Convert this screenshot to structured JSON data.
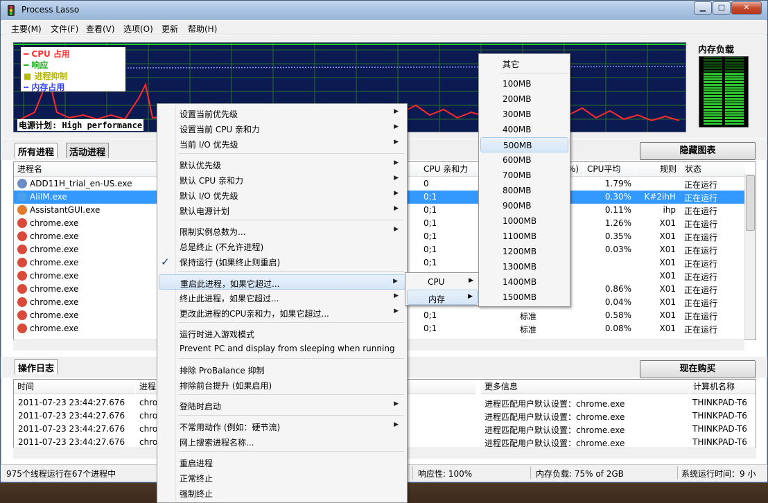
{
  "window": {
    "title": "Process Lasso",
    "min": "0",
    "max": "1",
    "close": "r"
  },
  "menu": [
    "主要(M)",
    "文件(F)",
    "查看(V)",
    "选项(O)",
    "更新",
    "帮助(H)"
  ],
  "graph": {
    "legend": [
      "CPU 占用",
      "响应",
      "进程抑制",
      "内存占用"
    ],
    "legend_colors": [
      "#ff3333",
      "#22cc22",
      "#dddd00",
      "#3344ff"
    ],
    "power_plan": "电源计划: High performance",
    "mem_title": "内存负载",
    "mem_fill": 0.75
  },
  "tabs": {
    "all": "所有进程",
    "active": "活动进程",
    "hide_graph": "隐藏图表",
    "log": "操作日志",
    "buy": "现在购买"
  },
  "proc_headers": {
    "name": "进程名",
    "affinity": "CPU 亲和力",
    "pct": "%)",
    "avg": "CPU平均",
    "rules": "规则",
    "status": "状态"
  },
  "processes": [
    {
      "name": "ADD11H_trial_en-US.exe",
      "aff": "0",
      "prio": "",
      "avg": "1.79%",
      "rule": "",
      "status": "正在运行",
      "icon": "#6b8cc4"
    },
    {
      "name": "AliIM.exe",
      "aff": "0;1",
      "prio": "",
      "avg": "0.30%",
      "rule": "K#2ihH",
      "status": "正在运行",
      "icon": "#4aa0e8",
      "sel": true
    },
    {
      "name": "AssistantGUI.exe",
      "aff": "0;1",
      "prio": "",
      "avg": "0.11%",
      "rule": "ihp",
      "status": "正在运行",
      "icon": "#e07a2c"
    },
    {
      "name": "chrome.exe",
      "aff": "0;1",
      "prio": "",
      "avg": "1.26%",
      "rule": "X01",
      "status": "正在运行",
      "icon": "#d94a3a"
    },
    {
      "name": "chrome.exe",
      "aff": "0;1",
      "prio": "",
      "avg": "0.35%",
      "rule": "X01",
      "status": "正在运行",
      "icon": "#d94a3a"
    },
    {
      "name": "chrome.exe",
      "aff": "0;1",
      "prio": "",
      "avg": "0.03%",
      "rule": "X01",
      "status": "正在运行",
      "icon": "#d94a3a"
    },
    {
      "name": "chrome.exe",
      "aff": "0;1",
      "prio": "",
      "avg": "",
      "rule": "X01",
      "status": "正在运行",
      "icon": "#d94a3a"
    },
    {
      "name": "chrome.exe",
      "aff": "",
      "prio": "",
      "avg": "",
      "rule": "X01",
      "status": "正在运行",
      "icon": "#d94a3a"
    },
    {
      "name": "chrome.exe",
      "aff": "",
      "prio": "",
      "avg": "0.86%",
      "rule": "X01",
      "status": "正在运行",
      "icon": "#d94a3a"
    },
    {
      "name": "chrome.exe",
      "aff": "",
      "prio": "",
      "avg": "0.04%",
      "rule": "X01",
      "status": "正在运行",
      "icon": "#d94a3a"
    },
    {
      "name": "chrome.exe",
      "aff": "0;1",
      "prio": "标准",
      "avg": "0.58%",
      "rule": "X01",
      "status": "正在运行",
      "icon": "#d94a3a"
    },
    {
      "name": "chrome.exe",
      "aff": "0;1",
      "prio": "标准",
      "avg": "0.08%",
      "rule": "X01",
      "status": "正在运行",
      "icon": "#d94a3a"
    }
  ],
  "log_headers": {
    "time": "时间",
    "proc": "进程",
    "info": "更多信息",
    "computer": "计算机名称"
  },
  "logs": [
    {
      "time": "2011-07-23 23:44:27.676",
      "proc": "chro",
      "info": "进程匹配用户默认设置：chrome.exe",
      "computer": "THINKPAD-T6"
    },
    {
      "time": "2011-07-23 23:44:27.676",
      "proc": "chro",
      "info": "进程匹配用户默认设置：chrome.exe",
      "computer": "THINKPAD-T6"
    },
    {
      "time": "2011-07-23 23:44:27.676",
      "proc": "chro",
      "info": "进程匹配用户默认设置：chrome.exe",
      "computer": "THINKPAD-T6"
    },
    {
      "time": "2011-07-23 23:44:27.676",
      "proc": "chro",
      "info": "进程匹配用户默认设置：chrome.exe",
      "computer": "THINKPAD-T6"
    }
  ],
  "status": {
    "threads": "975个线程运行在67个进程中",
    "resp": "响应性: 100%",
    "mem": "内存负载: 75% of 2GB",
    "uptime": "系统运行时间：9 小"
  },
  "context_menu": [
    {
      "label": "设置当前优先级",
      "sub": true
    },
    {
      "label": "设置当前 CPU 亲和力",
      "sub": true
    },
    {
      "label": "当前 I/O 优先级",
      "sub": true
    },
    {
      "sep": true
    },
    {
      "label": "默认优先级",
      "sub": true
    },
    {
      "label": "默认 CPU 亲和力",
      "sub": true
    },
    {
      "label": "默认 I/O 优先级",
      "sub": true
    },
    {
      "label": "默认电源计划",
      "sub": true
    },
    {
      "sep": true
    },
    {
      "label": "限制实例总数为...",
      "sub": true
    },
    {
      "label": "总是终止 (不允许进程)",
      "sub": false
    },
    {
      "label": "保持运行 (如果终止则重启)",
      "sub": false
    },
    {
      "sep": true
    },
    {
      "label": "重启此进程，如果它超过...",
      "sub": true,
      "hl": true
    },
    {
      "label": "终止此进程，如果它超过...",
      "sub": true
    },
    {
      "label": "更改此进程的CPU亲和力，如果它超过...",
      "sub": true
    },
    {
      "sep": true
    },
    {
      "label": "运行时进入游戏模式",
      "sub": false
    },
    {
      "label": "Prevent PC and display from sleeping when running",
      "sub": false
    },
    {
      "sep": true
    },
    {
      "label": "排除 ProBalance 抑制",
      "sub": false
    },
    {
      "label": "排除前台提升 (如果启用)",
      "sub": false
    },
    {
      "sep": true
    },
    {
      "label": "登陆时启动",
      "sub": true
    },
    {
      "sep": true
    },
    {
      "label": "不常用动作 (例如：硬节流)",
      "sub": true
    },
    {
      "label": "网上搜索进程名称...",
      "sub": false
    },
    {
      "sep": true
    },
    {
      "label": "重启进程",
      "sub": false
    },
    {
      "label": "正常终止",
      "sub": false
    },
    {
      "label": "强制终止",
      "sub": false
    }
  ],
  "submenu1": [
    {
      "label": "CPU"
    },
    {
      "label": "内存",
      "hl": true
    }
  ],
  "submenu2": [
    "其它",
    "100MB",
    "200MB",
    "300MB",
    "400MB",
    "500MB",
    "600MB",
    "700MB",
    "800MB",
    "900MB",
    "1000MB",
    "1100MB",
    "1200MB",
    "1300MB",
    "1400MB",
    "1500MB"
  ],
  "submenu2_selected": "500MB",
  "icons": {
    "arrow": "▶",
    "check": "✓"
  }
}
